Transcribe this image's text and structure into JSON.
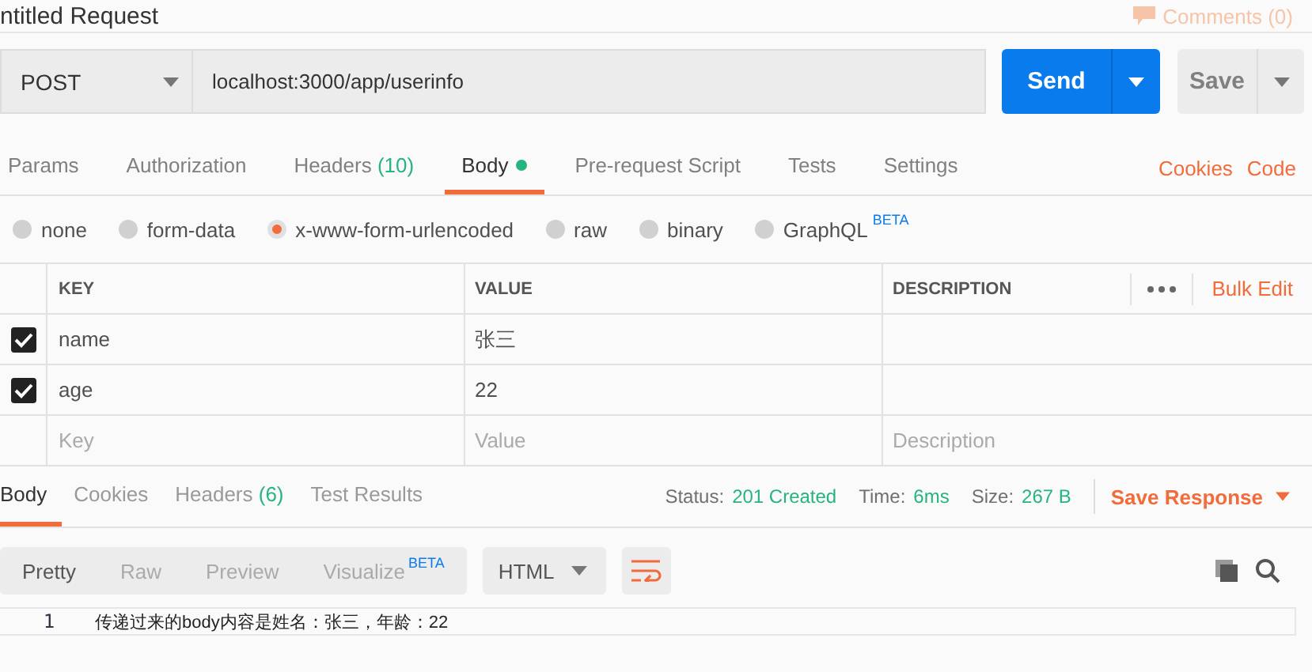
{
  "title": "ntitled Request",
  "comments": "Comments (0)",
  "request": {
    "method": "POST",
    "url": "localhost:3000/app/userinfo",
    "send": "Send",
    "save": "Save"
  },
  "tabs": [
    {
      "label": "Params",
      "selected": false
    },
    {
      "label": "Authorization",
      "selected": false
    },
    {
      "label": "Headers",
      "count": "(10)",
      "selected": false
    },
    {
      "label": "Body",
      "selected": true,
      "dot": true
    },
    {
      "label": "Pre-request Script",
      "selected": false
    },
    {
      "label": "Tests",
      "selected": false
    },
    {
      "label": "Settings",
      "selected": false
    }
  ],
  "links": [
    "Cookies",
    "Code"
  ],
  "body_types": [
    {
      "label": "none",
      "selected": false
    },
    {
      "label": "form-data",
      "selected": false
    },
    {
      "label": "x-www-form-urlencoded",
      "selected": true
    },
    {
      "label": "raw",
      "selected": false
    },
    {
      "label": "binary",
      "selected": false
    },
    {
      "label": "GraphQL",
      "badge": "BETA",
      "selected": false
    }
  ],
  "params": {
    "columns": [
      "KEY",
      "VALUE",
      "DESCRIPTION"
    ],
    "bulk_edit": "Bulk Edit",
    "rows": [
      {
        "checked": true,
        "key": "name",
        "value": "张三"
      },
      {
        "checked": true,
        "key": "age",
        "value": "22"
      }
    ],
    "new_row": {
      "key": {
        "placeholder": "Key"
      },
      "value": {
        "placeholder": "Value"
      },
      "description": {
        "placeholder": "Description"
      }
    }
  },
  "response": {
    "tabs": [
      {
        "label": "Body",
        "selected": true
      },
      {
        "label": "Cookies",
        "selected": false
      },
      {
        "label": "Headers",
        "count": "(6)",
        "selected": false
      },
      {
        "label": "Test Results",
        "selected": false
      }
    ],
    "status_label": "Status:",
    "status": "201 Created",
    "time_label": "Time:",
    "time": "6ms",
    "size_label": "Size:",
    "size": "267 B",
    "save_response": "Save Response",
    "views": [
      {
        "label": "Pretty",
        "selected": true
      },
      {
        "label": "Raw",
        "selected": false
      },
      {
        "label": "Preview",
        "selected": false
      },
      {
        "label": "Visualize",
        "badge": "BETA",
        "selected": false
      }
    ],
    "format": "HTML",
    "wrap_lines": true,
    "lines": [
      {
        "number": "1",
        "text": "传递过来的body内容是姓名：张三，年龄：22"
      }
    ]
  }
}
